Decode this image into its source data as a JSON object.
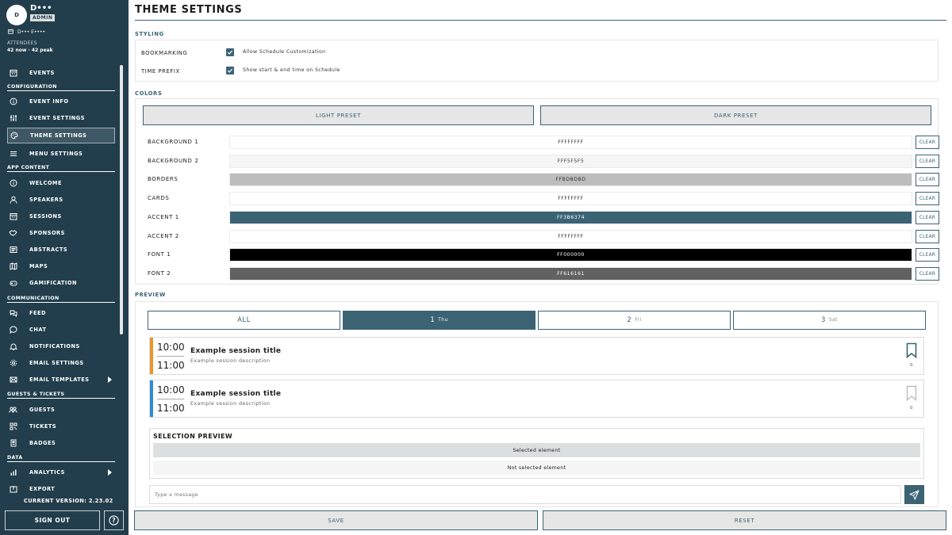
{
  "user": {
    "initial": "D",
    "name": "D•••",
    "role": "ADMIN",
    "org": "D••• E••••"
  },
  "attendees": {
    "label": "ATTENDEES",
    "value": "42 now · 42 peak"
  },
  "nav": {
    "events": "EVENTS",
    "sec_configuration": "CONFIGURATION",
    "event_info": "EVENT INFO",
    "event_settings": "EVENT SETTINGS",
    "theme_settings": "THEME SETTINGS",
    "menu_settings": "MENU SETTINGS",
    "sec_app_content": "APP CONTENT",
    "welcome": "WELCOME",
    "speakers": "SPEAKERS",
    "sessions": "SESSIONS",
    "sponsors": "SPONSORS",
    "abstracts": "ABSTRACTS",
    "maps": "MAPS",
    "gamification": "GAMIFICATION",
    "sec_communication": "COMMUNICATION",
    "feed": "FEED",
    "chat": "CHAT",
    "notifications": "NOTIFICATIONS",
    "email_settings": "EMAIL SETTINGS",
    "email_templates": "EMAIL TEMPLATES",
    "sec_guests": "GUESTS & TICKETS",
    "guests": "GUESTS",
    "tickets": "TICKETS",
    "badges": "BADGES",
    "sec_data": "DATA",
    "analytics": "ANALYTICS",
    "export": "EXPORT"
  },
  "version": "CURRENT VERSION: 2.23.02",
  "sign_out": "SIGN OUT",
  "help_icon": "?",
  "page_title": "THEME SETTINGS",
  "styling": {
    "title": "STYLING",
    "bookmarking_label": "BOOKMARKING",
    "bookmarking_text": "Allow Schedule Customization",
    "bookmarking_checked": true,
    "time_prefix_label": "TIME PREFIX",
    "time_prefix_text": "Show start & end time on Schedule",
    "time_prefix_checked": true
  },
  "colors": {
    "title": "COLORS",
    "light_preset": "LIGHT PRESET",
    "dark_preset": "DARK PRESET",
    "clear_label": "CLEAR",
    "rows": [
      {
        "label": "BACKGROUND 1",
        "value": "FFFFFFFF",
        "bg": "#FFFFFF",
        "fg": "#333333"
      },
      {
        "label": "BACKGROUND 2",
        "value": "FFF5F5F5",
        "bg": "#F5F5F5",
        "fg": "#333333"
      },
      {
        "label": "BORDERS",
        "value": "FFBDBDBD",
        "bg": "#BDBDBD",
        "fg": "#333333"
      },
      {
        "label": "CARDS",
        "value": "FFFFFFFF",
        "bg": "#FFFFFF",
        "fg": "#333333"
      },
      {
        "label": "ACCENT 1",
        "value": "FF3B6374",
        "bg": "#3B6374",
        "fg": "#FFFFFF"
      },
      {
        "label": "ACCENT 2",
        "value": "FFFFFFFF",
        "bg": "#FFFFFF",
        "fg": "#333333"
      },
      {
        "label": "FONT 1",
        "value": "FF000000",
        "bg": "#000000",
        "fg": "#FFFFFF"
      },
      {
        "label": "FONT 2",
        "value": "FF616161",
        "bg": "#616161",
        "fg": "#FFFFFF"
      }
    ]
  },
  "preview": {
    "title": "PREVIEW",
    "tabs": [
      {
        "num": "ALL",
        "day": ""
      },
      {
        "num": "1",
        "day": "Thu"
      },
      {
        "num": "2",
        "day": "Fri"
      },
      {
        "num": "3",
        "day": "Sat"
      }
    ],
    "selected_tab": 1,
    "sessions": [
      {
        "start": "10:00",
        "end": "11:00",
        "title": "Example session title",
        "desc": "Example session description",
        "color": "#E8962E",
        "bookmarked": true,
        "count": "0"
      },
      {
        "start": "10:00",
        "end": "11:00",
        "title": "Example session title",
        "desc": "Example session description",
        "color": "#2F8BD6",
        "bookmarked": false,
        "count": "0"
      }
    ],
    "selection_title": "SELECTION PREVIEW",
    "selected_text": "Selected element",
    "not_selected_text": "Not selected element",
    "message_placeholder": "Type a message"
  },
  "save": "SAVE",
  "reset": "RESET",
  "accent": "#3B6374",
  "sidebar_bg": "#223E4C"
}
